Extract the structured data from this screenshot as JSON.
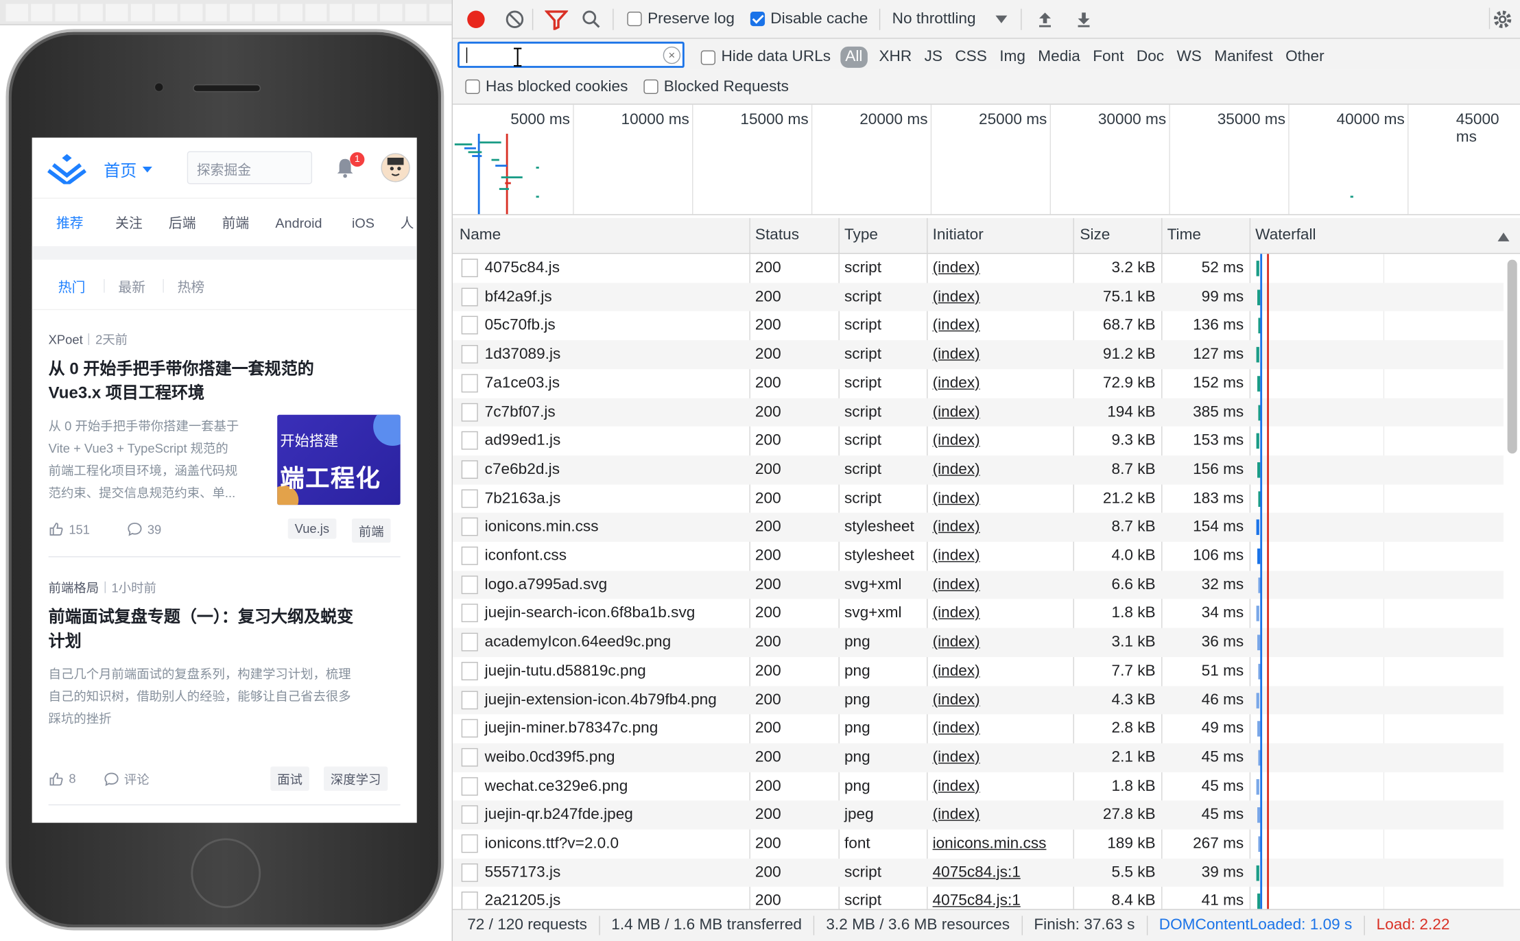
{
  "mobile": {
    "home_label": "首页",
    "search_placeholder": "探索掘金",
    "notification_count": "1",
    "nav_tabs": [
      "推荐",
      "关注",
      "后端",
      "前端",
      "Android",
      "iOS",
      "人"
    ],
    "sub_tabs": [
      "热门",
      "最新",
      "热榜"
    ],
    "articles": [
      {
        "author": "XPoet",
        "time": "2天前",
        "title_line1": "从 0 开始手把手带你搭建一套规范的",
        "title_line2": "Vue3.x 项目工程环境",
        "desc_line1": "从 0 开始手把手带你搭建一套基于",
        "desc_line2": "Vite + Vue3 + TypeScript 规范的",
        "desc_line3": "前端工程化项目环境，涵盖代码规",
        "desc_line4": "范约束、提交信息规范约束、单...",
        "thumb_line1": "开始搭建",
        "thumb_line2": "端工程化",
        "likes": "151",
        "comments": "39",
        "tags": [
          "Vue.js",
          "前端"
        ]
      },
      {
        "author": "前端格局",
        "time": "1小时前",
        "title_line1": "前端面试复盘专题（一）：复习大纲及蜕变",
        "title_line2": "计划",
        "desc_line1": "自己几个月前端面试的复盘系列，构建学习计划，梳理",
        "desc_line2": "自己的知识树，借助别人的经验，能够让自己省去很多",
        "desc_line3": "踩坑的挫折",
        "likes": "8",
        "comments": "评论",
        "tags": [
          "面试",
          "深度学习"
        ]
      }
    ]
  },
  "devtools": {
    "toolbar": {
      "preserve_log": "Preserve log",
      "disable_cache": "Disable cache",
      "throttling": "No throttling"
    },
    "filter": {
      "value": "",
      "hide_data_urls": "Hide data URLs",
      "types": [
        "All",
        "XHR",
        "JS",
        "CSS",
        "Img",
        "Media",
        "Font",
        "Doc",
        "WS",
        "Manifest",
        "Other"
      ],
      "has_blocked_cookies": "Has blocked cookies",
      "blocked_requests": "Blocked Requests"
    },
    "timeline_ticks": [
      "5000 ms",
      "10000 ms",
      "15000 ms",
      "20000 ms",
      "25000 ms",
      "30000 ms",
      "35000 ms",
      "40000 ms",
      "45000 ms"
    ],
    "columns": [
      "Name",
      "Status",
      "Type",
      "Initiator",
      "Size",
      "Time",
      "Waterfall"
    ],
    "rows": [
      {
        "name": "4075c84.js",
        "status": "200",
        "type": "script",
        "initiator": "(index)",
        "size": "3.2 kB",
        "time": "52 ms"
      },
      {
        "name": "bf42a9f.js",
        "status": "200",
        "type": "script",
        "initiator": "(index)",
        "size": "75.1 kB",
        "time": "99 ms"
      },
      {
        "name": "05c70fb.js",
        "status": "200",
        "type": "script",
        "initiator": "(index)",
        "size": "68.7 kB",
        "time": "136 ms"
      },
      {
        "name": "1d37089.js",
        "status": "200",
        "type": "script",
        "initiator": "(index)",
        "size": "91.2 kB",
        "time": "127 ms"
      },
      {
        "name": "7a1ce03.js",
        "status": "200",
        "type": "script",
        "initiator": "(index)",
        "size": "72.9 kB",
        "time": "152 ms"
      },
      {
        "name": "7c7bf07.js",
        "status": "200",
        "type": "script",
        "initiator": "(index)",
        "size": "194 kB",
        "time": "385 ms"
      },
      {
        "name": "ad99ed1.js",
        "status": "200",
        "type": "script",
        "initiator": "(index)",
        "size": "9.3 kB",
        "time": "153 ms"
      },
      {
        "name": "c7e6b2d.js",
        "status": "200",
        "type": "script",
        "initiator": "(index)",
        "size": "8.7 kB",
        "time": "156 ms"
      },
      {
        "name": "7b2163a.js",
        "status": "200",
        "type": "script",
        "initiator": "(index)",
        "size": "21.2 kB",
        "time": "183 ms"
      },
      {
        "name": "ionicons.min.css",
        "status": "200",
        "type": "stylesheet",
        "initiator": "(index)",
        "size": "8.7 kB",
        "time": "154 ms"
      },
      {
        "name": "iconfont.css",
        "status": "200",
        "type": "stylesheet",
        "initiator": "(index)",
        "size": "4.0 kB",
        "time": "106 ms"
      },
      {
        "name": "logo.a7995ad.svg",
        "status": "200",
        "type": "svg+xml",
        "initiator": "(index)",
        "size": "6.6 kB",
        "time": "32 ms"
      },
      {
        "name": "juejin-search-icon.6f8ba1b.svg",
        "status": "200",
        "type": "svg+xml",
        "initiator": "(index)",
        "size": "1.8 kB",
        "time": "34 ms"
      },
      {
        "name": "academyIcon.64eed9c.png",
        "status": "200",
        "type": "png",
        "initiator": "(index)",
        "size": "3.1 kB",
        "time": "36 ms"
      },
      {
        "name": "juejin-tutu.d58819c.png",
        "status": "200",
        "type": "png",
        "initiator": "(index)",
        "size": "7.7 kB",
        "time": "51 ms"
      },
      {
        "name": "juejin-extension-icon.4b79fb4.png",
        "status": "200",
        "type": "png",
        "initiator": "(index)",
        "size": "4.3 kB",
        "time": "46 ms"
      },
      {
        "name": "juejin-miner.b78347c.png",
        "status": "200",
        "type": "png",
        "initiator": "(index)",
        "size": "2.8 kB",
        "time": "49 ms"
      },
      {
        "name": "weibo.0cd39f5.png",
        "status": "200",
        "type": "png",
        "initiator": "(index)",
        "size": "2.1 kB",
        "time": "45 ms"
      },
      {
        "name": "wechat.ce329e6.png",
        "status": "200",
        "type": "png",
        "initiator": "(index)",
        "size": "1.8 kB",
        "time": "45 ms"
      },
      {
        "name": "juejin-qr.b247fde.jpeg",
        "status": "200",
        "type": "jpeg",
        "initiator": "(index)",
        "size": "27.8 kB",
        "time": "45 ms"
      },
      {
        "name": "ionicons.ttf?v=2.0.0",
        "status": "200",
        "type": "font",
        "initiator": "ionicons.min.css",
        "size": "189 kB",
        "time": "267 ms"
      },
      {
        "name": "5557173.js",
        "status": "200",
        "type": "script",
        "initiator": "4075c84.js:1",
        "size": "5.5 kB",
        "time": "39 ms"
      },
      {
        "name": "2a21205.js",
        "status": "200",
        "type": "script",
        "initiator": "4075c84.js:1",
        "size": "8.4 kB",
        "time": "41 ms"
      }
    ],
    "status": {
      "requests": "72 / 120 requests",
      "transferred": "1.4 MB / 1.6 MB transferred",
      "resources": "3.2 MB / 3.6 MB resources",
      "finish": "Finish: 37.63 s",
      "dcl": "DOMContentLoaded: 1.09 s",
      "load": "Load: 2.22"
    },
    "colors": {
      "accent": "#1a73e8",
      "record": "#e8271d",
      "filter_active": "#d93025",
      "dcl": "#1a73e8",
      "load": "#d93025"
    }
  }
}
